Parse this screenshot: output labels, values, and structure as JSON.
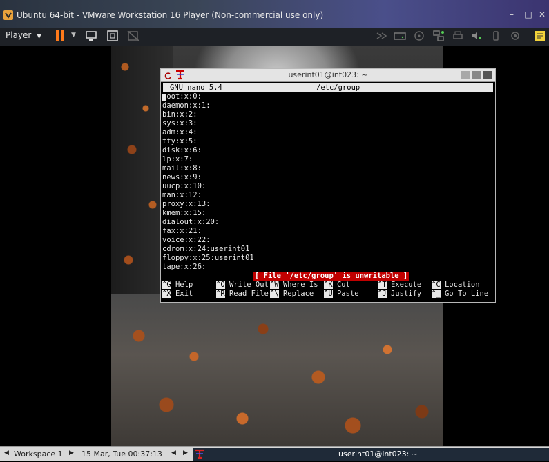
{
  "window": {
    "title": "Ubuntu 64-bit - VMware Workstation 16 Player (Non-commercial use only)",
    "controls": {
      "minimize": "–",
      "maximize": "□",
      "close": "✕"
    }
  },
  "toolbar": {
    "player_label": "Player",
    "icons": [
      "pause-icon",
      "send-ctrl-alt-del-icon",
      "fit-guest-icon",
      "unity-icon",
      "forward-icon",
      "hard-disk-icon",
      "cd-icon",
      "network-icon",
      "printer-icon",
      "sound-icon",
      "usb-icon",
      "camera-icon",
      "notes-icon"
    ]
  },
  "terminal": {
    "title": "userint01@int023: ~",
    "nano_version": "GNU nano 5.4",
    "filename": "/etc/group",
    "lines": [
      "root:x:0:",
      "daemon:x:1:",
      "bin:x:2:",
      "sys:x:3:",
      "adm:x:4:",
      "tty:x:5:",
      "disk:x:6:",
      "lp:x:7:",
      "mail:x:8:",
      "news:x:9:",
      "uucp:x:10:",
      "man:x:12:",
      "proxy:x:13:",
      "kmem:x:15:",
      "dialout:x:20:",
      "fax:x:21:",
      "voice:x:22:",
      "cdrom:x:24:userint01",
      "floppy:x:25:userint01",
      "tape:x:26:"
    ],
    "status": "[ File '/etc/group' is unwritable ]",
    "shortcuts_row1": [
      {
        "key": "^G",
        "label": "Help"
      },
      {
        "key": "^O",
        "label": "Write Out"
      },
      {
        "key": "^W",
        "label": "Where Is"
      },
      {
        "key": "^K",
        "label": "Cut"
      },
      {
        "key": "^T",
        "label": "Execute"
      },
      {
        "key": "^C",
        "label": "Location"
      }
    ],
    "shortcuts_row2": [
      {
        "key": "^X",
        "label": "Exit"
      },
      {
        "key": "^R",
        "label": "Read File"
      },
      {
        "key": "^\\",
        "label": "Replace"
      },
      {
        "key": "^U",
        "label": "Paste"
      },
      {
        "key": "^J",
        "label": "Justify"
      },
      {
        "key": "^_",
        "label": "Go To Line"
      }
    ]
  },
  "panel": {
    "workspace": "Workspace 1",
    "datetime": "15 Mar, Tue 00:37:13",
    "task_title": "userint01@int023: ~"
  },
  "colors": {
    "status_bg": "#c00000",
    "toolbar_bg": "#1e2126",
    "pause": "#ff7a1a"
  }
}
